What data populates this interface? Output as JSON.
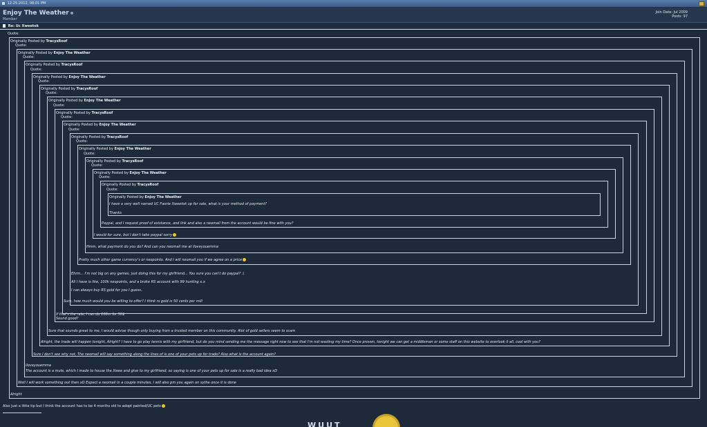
{
  "topbar": {
    "datetime": "12-25-2012, 08:01 PM",
    "postnum_icon": "post-link-icon"
  },
  "user": {
    "name": "Enjoy The Weather",
    "title": "Member",
    "join": "Join Date: Jul 2009",
    "posts": "Posts: 97"
  },
  "thread_title": "Re: Uc Xweetok",
  "quote_label": "Quote:",
  "originally_posted_by": "Originally Posted by",
  "quotes": [
    {
      "by": "TracysRoof",
      "reply": [
        "Alright"
      ]
    },
    {
      "by": "Enjoy The Weather",
      "reply": [
        "Well I will work something out then xD Expect a neomail in a couple minutes, I will also pm you again on sythe once it is done"
      ]
    },
    {
      "by": "TracysRoof",
      "reply": [
        "iloveyouemma",
        "The account is a mule, which I made to house the Xwee and give to my girlfriend, so saying is one of your pets up for sale is a really bad idea xD"
      ]
    },
    {
      "by": "Enjoy The Weather",
      "reply": [
        "Sure I don't see why not, The neomail will say something along the lines of is one of your pets up for trade? Also what is the account again?"
      ]
    },
    {
      "by": "TracysRoof",
      "reply": [
        "Alright, the trade will happen tonight, Alright? I have to go play tennis with my girlfriend, but do you mind sending me the message right now to see that I'm not wasting my time? Once proven, tonight we can get a middleman or some staff on this website to overlook it all, cool with you?"
      ]
    },
    {
      "by": "Enjoy The Weather",
      "reply": [
        "Sure that sounds great to me, I would advise though only buying from a trusted member on this community. Alot of gold sellers seem to scam"
      ]
    },
    {
      "by": "TracysRoof",
      "reply": [
        "If that's the rate, I can do 100m for 50$",
        "Sound good?"
      ]
    },
    {
      "by": "Enjoy The Weather",
      "reply": [
        "Sure, how much would you be willing to offer? I think rs gold is 50 cents per mill"
      ]
    },
    {
      "by": "TracysRoof",
      "reply": [
        "Ehrm... I'm not big on any games, just doing this for my girlfriend... You sure you can't do paypal? :\\",
        "All I have is like, 100k neopoints, and a broke RS account with 99 hunting x.x",
        "I can always buy RS gold for you I guess.."
      ]
    },
    {
      "by": "Enjoy The Weather",
      "reply": [
        "Pretty much other game currency's or neopoints. And I will neomail you if we agree on a price"
      ]
    },
    {
      "by": "TracysRoof",
      "reply": [
        "Hmm, what payment do you do? And can you neomail me at iloveyouemma"
      ]
    },
    {
      "by": "Enjoy The Weather",
      "reply": [
        "I would for sure, but I don't take paypal sorry"
      ]
    },
    {
      "by": "TracysRoof",
      "reply": [
        "Paypal, and I request proof of existance, and link and also a neomail from the account would be fine with you?"
      ]
    },
    {
      "by": "Enjoy The Weather",
      "reply": [
        "I have a very well named UC Faerie Xweetok up for sale, what is your method of payment?",
        "Thanks"
      ]
    }
  ],
  "post_footer": "Also just a little tip but I think the account has to be 4 months old to adopt painted/UC pets",
  "signature": {
    "text": "WUUT"
  }
}
